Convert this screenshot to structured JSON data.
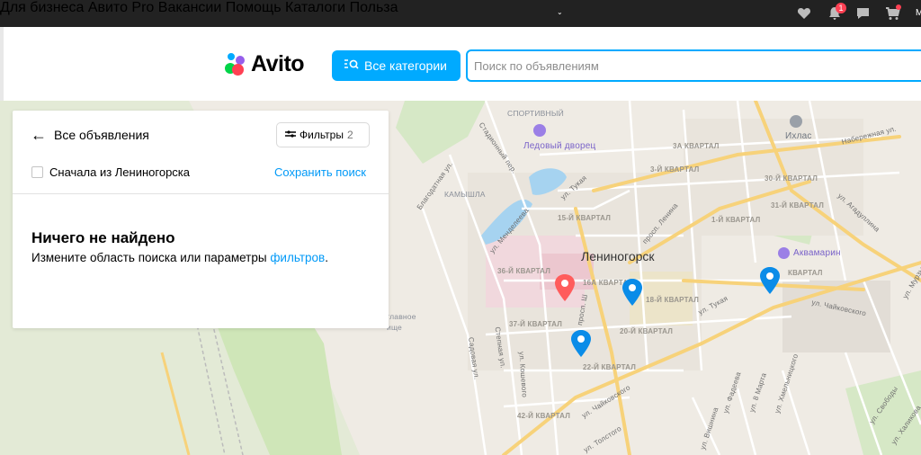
{
  "topbar": {
    "links": [
      "Для бизнеса",
      "Авито Pro",
      "Вакансии",
      "Помощь",
      "Каталоги",
      "Польза"
    ],
    "notification_count": "1",
    "user_initial": "М",
    "icons": [
      "heart-icon",
      "bell-icon",
      "chat-icon",
      "cart-icon"
    ]
  },
  "header": {
    "logo_text": "Avito",
    "categories_button": "Все категории",
    "search_placeholder": "Поиск по объявлениям"
  },
  "panel": {
    "back_label": "Все объявления",
    "filters_label": "Фильтры",
    "filters_count": "2",
    "checkbox_label": "Сначала из Лениногорска",
    "checkbox_checked": false,
    "save_search": "Сохранить поиск",
    "nothing_found_title": "Ничего не найдено",
    "nothing_found_text": "Измените область поиска или параметры ",
    "nothing_found_link": "фильтров",
    "nothing_found_end": "."
  },
  "map": {
    "city": "Лениногорск",
    "places": [
      "СПОРТИВНЫЙ",
      "Ледовый дворец",
      "Ихлас",
      "Аквамарин",
      "КАМЫШЛА"
    ],
    "districts": [
      "3А КВАРТАЛ",
      "3-Й КВАРТАЛ",
      "30-Й КВАРТАЛ",
      "31-Й КВАРТАЛ",
      "1-Й КВАРТАЛ",
      "15-Й КВАРТАЛ",
      "36-Й КВАРТАЛ",
      "16А КВАРТАЛ",
      "18-Й КВАРТАЛ",
      "37-Й КВАРТАЛ",
      "20-Й КВАРТАЛ",
      "22-Й КВАРТАЛ",
      "42-Й КВАРТАЛ",
      "КВАРТАЛ"
    ],
    "streets": [
      "Набережная ул.",
      "ул. Агадуллина",
      "Стадионный пер.",
      "ул. Тукая",
      "просп. Ленина",
      "ул. Менделеева",
      "Благодатная ул.",
      "ул. Чайковского",
      "Садовая ул.",
      "Степная ул.",
      "ул. Кошевого",
      "ул. Толстого",
      "ул. Фадеева",
      "ул. Вишнина",
      "ул. 8 Марта",
      "ул. Хмельницкого",
      "ул. Свободы",
      "ул. Халикова",
      "ул. Мурзы",
      "просп. Ш",
      "ул. Тукая",
      "ул. Чайковского"
    ],
    "cemetery_fragment": [
      "главное",
      "ище"
    ],
    "colors": {
      "pin_blue": "#0a8ce8",
      "pin_red": "#ff5c5c",
      "road_yellow": "#f7d27a",
      "water": "#a6d3f0",
      "park": "#cfe6b8"
    }
  }
}
